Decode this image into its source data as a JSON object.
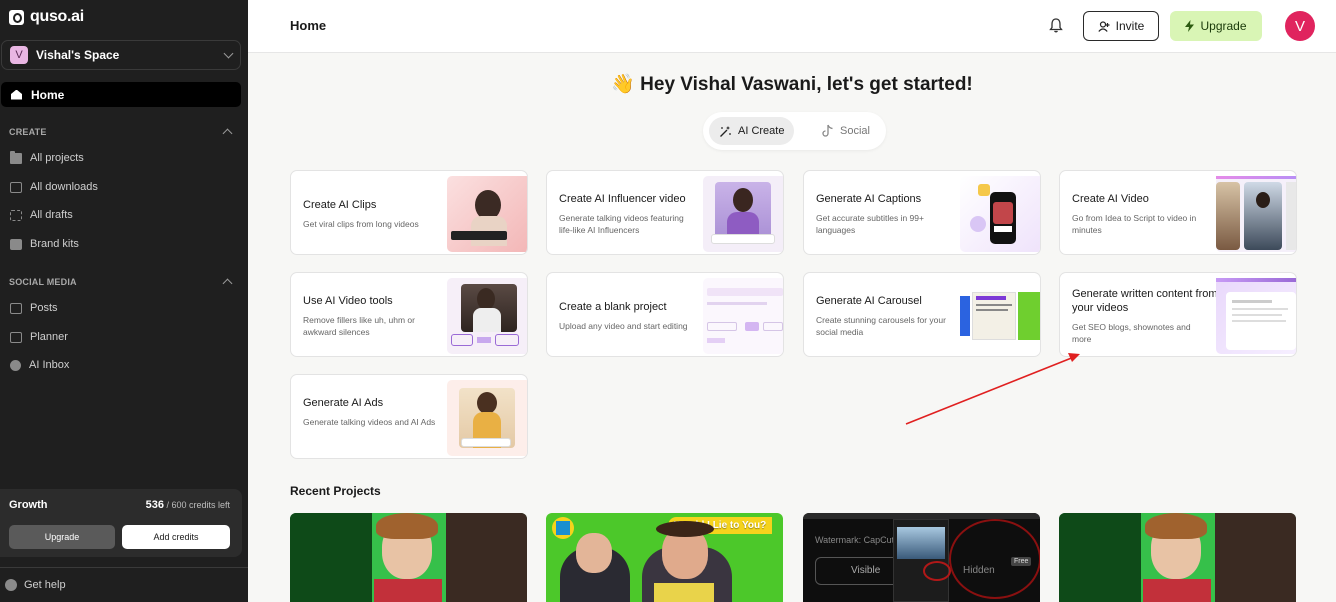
{
  "brand": {
    "name": "quso.ai"
  },
  "workspace": {
    "avatar_letter": "V",
    "name": "Vishal's Space"
  },
  "sidebar": {
    "home_label": "Home",
    "create_section": "CREATE",
    "create_items": [
      {
        "label": "All projects",
        "icon": "folder-icon"
      },
      {
        "label": "All downloads",
        "icon": "download-icon"
      },
      {
        "label": "All drafts",
        "icon": "drafts-icon"
      },
      {
        "label": "Brand kits",
        "icon": "brand-kit-icon"
      }
    ],
    "social_section": "SOCIAL MEDIA",
    "social_items": [
      {
        "label": "Posts",
        "icon": "posts-icon"
      },
      {
        "label": "Planner",
        "icon": "planner-icon"
      },
      {
        "label": "AI Inbox",
        "icon": "inbox-icon"
      }
    ],
    "plan": {
      "name": "Growth",
      "credits_used": "536",
      "credits_total": " / 600 credits left",
      "upgrade_label": "Upgrade",
      "add_credits_label": "Add credits"
    },
    "help_label": "Get help"
  },
  "header": {
    "title": "Home",
    "invite_label": "Invite",
    "upgrade_label": "Upgrade",
    "avatar_letter": "V"
  },
  "main": {
    "greeting": "👋 Hey Vishal Vaswani, let's get started!",
    "tabs": [
      {
        "label": "AI Create",
        "active": true
      },
      {
        "label": "Social",
        "active": false
      }
    ],
    "cards": [
      {
        "title": "Create AI Clips",
        "desc": "Get viral clips from long videos"
      },
      {
        "title": "Create AI Influencer video",
        "desc": "Generate talking videos featuring life-like AI Influencers"
      },
      {
        "title": "Generate AI Captions",
        "desc": "Get accurate subtitles in 99+ languages"
      },
      {
        "title": "Create AI Video",
        "desc": "Go from Idea to Script to video in minutes"
      },
      {
        "title": "Use AI Video tools",
        "desc": "Remove fillers like uh, uhm or awkward silences"
      },
      {
        "title": "Create a blank project",
        "desc": "Upload any video and start editing"
      },
      {
        "title": "Generate AI Carousel",
        "desc": "Create stunning carousels for your social media"
      },
      {
        "title": "Generate written content from your videos",
        "desc": "Get SEO blogs, shownotes and more"
      },
      {
        "title": "Generate AI Ads",
        "desc": "Generate talking videos and AI Ads"
      }
    ],
    "recent_title": "Recent Projects",
    "recent_captions": [
      "Would I Lie to You?",
      "Watermark: CapCut",
      "Visible",
      "Hidden",
      "Free"
    ]
  },
  "colors": {
    "sidebar": "#1f1f1f",
    "upgrade": "#d9f5b5",
    "avatar": "#e0245e",
    "annotation_arrow": "#e02020"
  }
}
